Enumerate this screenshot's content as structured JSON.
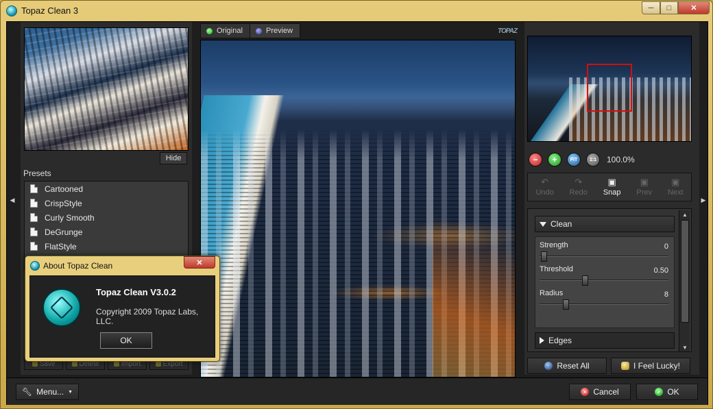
{
  "window": {
    "title": "Topaz Clean 3"
  },
  "left_panel": {
    "hide_label": "Hide",
    "presets_label": "Presets",
    "presets": [
      "Cartooned",
      "CrispStyle",
      "Curly Smooth",
      "DeGrunge",
      "FlatStyle"
    ],
    "buttons": {
      "save": "Save",
      "delete": "Delete",
      "import": "Import",
      "export": "Export"
    }
  },
  "tabs": {
    "original": "Original",
    "preview": "Preview"
  },
  "navigator": {
    "zoom_value": "100.0%",
    "fit_label": "FIT",
    "one_label": "1:1"
  },
  "history": {
    "undo": "Undo",
    "redo": "Redo",
    "snap": "Snap",
    "prev": "Prev",
    "next": "Next"
  },
  "adjustments": {
    "clean_section": "Clean",
    "edges_section": "Edges",
    "strength": {
      "label": "Strength",
      "value": "0",
      "fraction": 0.03
    },
    "threshold": {
      "label": "Threshold",
      "value": "0.50",
      "fraction": 0.35
    },
    "radius": {
      "label": "Radius",
      "value": "8",
      "fraction": 0.2
    }
  },
  "actions": {
    "reset_all": "Reset All",
    "feel_lucky": "I Feel Lucky!"
  },
  "footer": {
    "menu": "Menu...",
    "cancel": "Cancel",
    "ok": "OK"
  },
  "about_dialog": {
    "title": "About Topaz Clean",
    "product": "Topaz Clean V3.0.2",
    "copyright": "Copyright 2009 Topaz Labs, LLC.",
    "ok": "OK"
  }
}
